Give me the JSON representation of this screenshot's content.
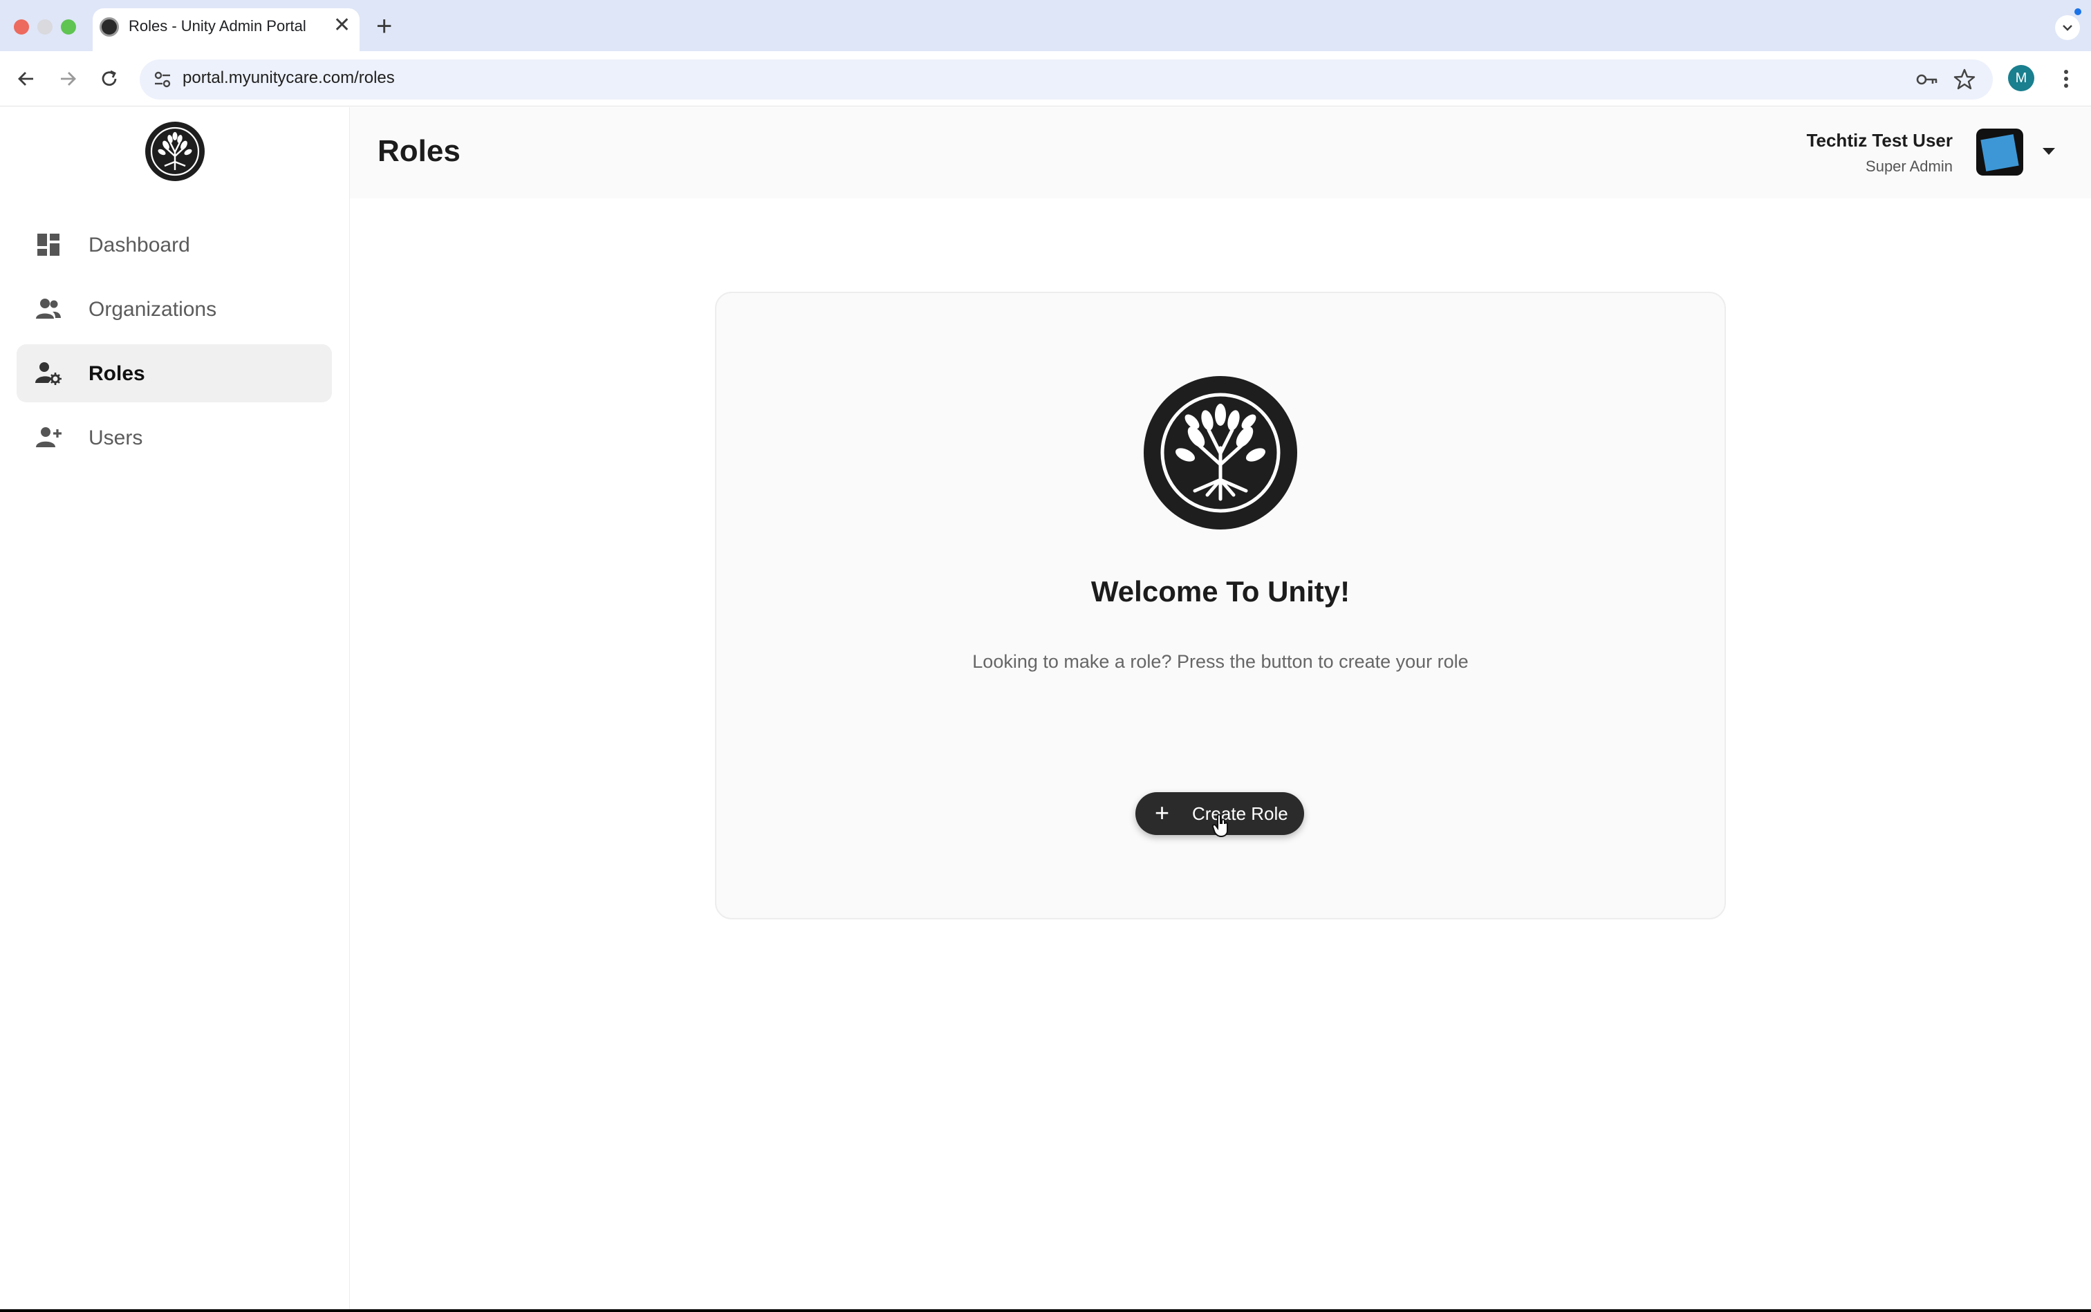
{
  "browser": {
    "tab_title": "Roles - Unity Admin Portal",
    "tab_close": "✕",
    "new_tab": "+",
    "url": "portal.myunitycare.com/roles",
    "profile_initial": "M"
  },
  "sidebar": {
    "items": [
      {
        "label": "Dashboard",
        "icon": "dashboard-icon",
        "active": false
      },
      {
        "label": "Organizations",
        "icon": "organizations-icon",
        "active": false
      },
      {
        "label": "Roles",
        "icon": "roles-icon",
        "active": true
      },
      {
        "label": "Users",
        "icon": "add-user-icon",
        "active": false
      }
    ]
  },
  "header": {
    "title": "Roles",
    "user_name": "Techtiz Test User",
    "user_role": "Super Admin"
  },
  "main": {
    "welcome_title": "Welcome To Unity!",
    "welcome_message": "Looking to make a role? Press the button to create your role",
    "create_button_icon": "+",
    "create_button_label": "Create Role"
  },
  "colors": {
    "accent_dark": "#2b2b2b",
    "active_nav_bg": "#f0f0f0",
    "avatar_tile": "#3d97d6"
  }
}
